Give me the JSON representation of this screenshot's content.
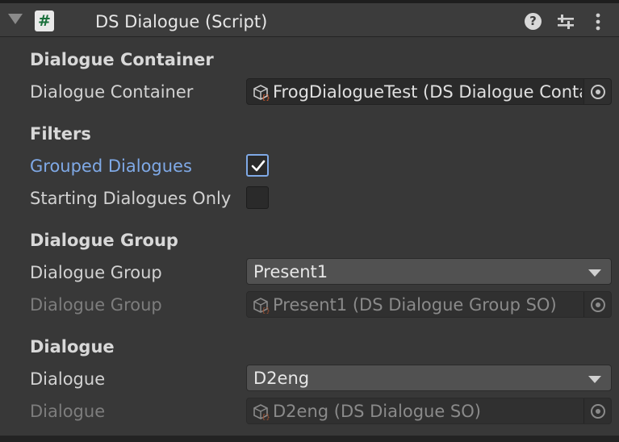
{
  "header": {
    "script_icon_glyph": "#",
    "title": "DS Dialogue (Script)",
    "help_glyph": "?",
    "icons": [
      "foldout-arrow-icon",
      "script-icon",
      "help-icon",
      "presets-icon",
      "kebab-menu-icon"
    ]
  },
  "sections": {
    "dialogue_container": {
      "title": "Dialogue Container",
      "field_label": "Dialogue Container",
      "field_value": "FrogDialogueTest (DS Dialogue Container SO)"
    },
    "filters": {
      "title": "Filters",
      "grouped_label": "Grouped Dialogues",
      "grouped_checked": true,
      "starting_label": "Starting Dialogues Only",
      "starting_checked": false
    },
    "dialogue_group": {
      "title": "Dialogue Group",
      "dropdown_label": "Dialogue Group",
      "dropdown_value": "Present1",
      "object_label": "Dialogue Group",
      "object_value": "Present1 (DS Dialogue Group SO)"
    },
    "dialogue": {
      "title": "Dialogue",
      "dropdown_label": "Dialogue",
      "dropdown_value": "D2eng",
      "object_label": "Dialogue",
      "object_value": "D2eng (DS Dialogue SO)"
    }
  },
  "colors": {
    "background": "#383838",
    "header": "#3c3c3c",
    "accent_blue": "#7fa9e6",
    "field_bg": "#2a2a2a",
    "dropdown_bg": "#515151"
  }
}
